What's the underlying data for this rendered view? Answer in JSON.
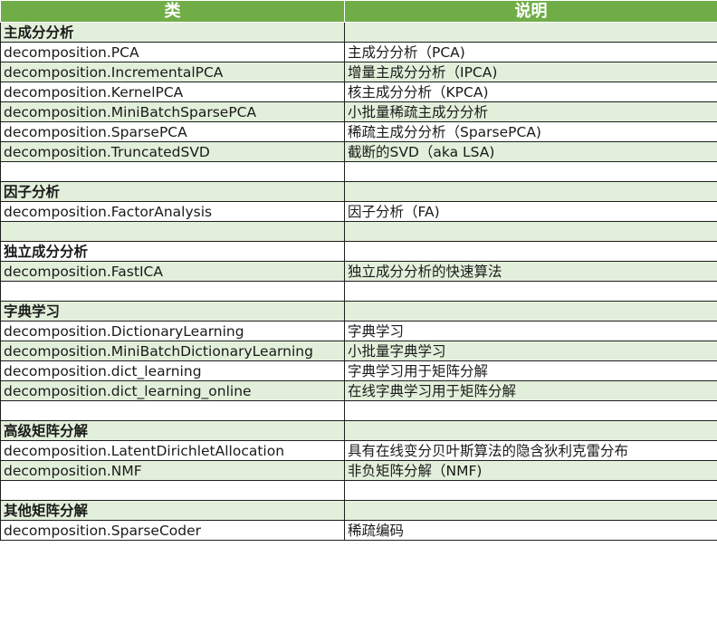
{
  "headers": {
    "col1": "类",
    "col2": "说明"
  },
  "rows": [
    {
      "kind": "section",
      "shade": "g",
      "name": "主成分分析",
      "desc": ""
    },
    {
      "kind": "item",
      "shade": "w",
      "name": "decomposition.PCA",
      "desc": "主成分分析（PCA)"
    },
    {
      "kind": "item",
      "shade": "g",
      "name": "decomposition.IncrementalPCA",
      "desc": "增量主成分分析（IPCA)"
    },
    {
      "kind": "item",
      "shade": "w",
      "name": "decomposition.KernelPCA",
      "desc": "核主成分分析（KPCA)"
    },
    {
      "kind": "item",
      "shade": "g",
      "name": "decomposition.MiniBatchSparsePCA",
      "desc": "小批量稀疏主成分分析"
    },
    {
      "kind": "item",
      "shade": "w",
      "name": "decomposition.SparsePCA",
      "desc": "稀疏主成分分析（SparsePCA)"
    },
    {
      "kind": "item",
      "shade": "g",
      "name": "decomposition.TruncatedSVD",
      "desc": "截断的SVD（aka LSA)"
    },
    {
      "kind": "blank",
      "shade": "w",
      "name": "",
      "desc": ""
    },
    {
      "kind": "section",
      "shade": "g",
      "name": "因子分析",
      "desc": ""
    },
    {
      "kind": "item",
      "shade": "w",
      "name": "decomposition.FactorAnalysis",
      "desc": "因子分析（FA)"
    },
    {
      "kind": "blank",
      "shade": "g",
      "name": "",
      "desc": ""
    },
    {
      "kind": "section",
      "shade": "w",
      "name": "独立成分分析",
      "desc": ""
    },
    {
      "kind": "item",
      "shade": "g",
      "name": "decomposition.FastICA",
      "desc": "独立成分分析的快速算法"
    },
    {
      "kind": "blank",
      "shade": "w",
      "name": "",
      "desc": ""
    },
    {
      "kind": "section",
      "shade": "g",
      "name": "字典学习",
      "desc": ""
    },
    {
      "kind": "item",
      "shade": "w",
      "name": "decomposition.DictionaryLearning",
      "desc": "字典学习"
    },
    {
      "kind": "item",
      "shade": "g",
      "name": "decomposition.MiniBatchDictionaryLearning",
      "desc": "小批量字典学习"
    },
    {
      "kind": "item",
      "shade": "w",
      "name": "decomposition.dict_learning",
      "desc": "字典学习用于矩阵分解"
    },
    {
      "kind": "item",
      "shade": "g",
      "name": "decomposition.dict_learning_online",
      "desc": "在线字典学习用于矩阵分解"
    },
    {
      "kind": "blank",
      "shade": "w",
      "name": "",
      "desc": ""
    },
    {
      "kind": "section",
      "shade": "g",
      "name": "高级矩阵分解",
      "desc": ""
    },
    {
      "kind": "item",
      "shade": "w",
      "name": "decomposition.LatentDirichletAllocation",
      "desc": "具有在线变分贝叶斯算法的隐含狄利克雷分布"
    },
    {
      "kind": "item",
      "shade": "g",
      "name": "decomposition.NMF",
      "desc": "非负矩阵分解（NMF)"
    },
    {
      "kind": "blank",
      "shade": "w",
      "name": "",
      "desc": ""
    },
    {
      "kind": "section",
      "shade": "g",
      "name": "其他矩阵分解",
      "desc": ""
    },
    {
      "kind": "item",
      "shade": "w",
      "name": "decomposition.SparseCoder",
      "desc": "稀疏编码"
    }
  ]
}
